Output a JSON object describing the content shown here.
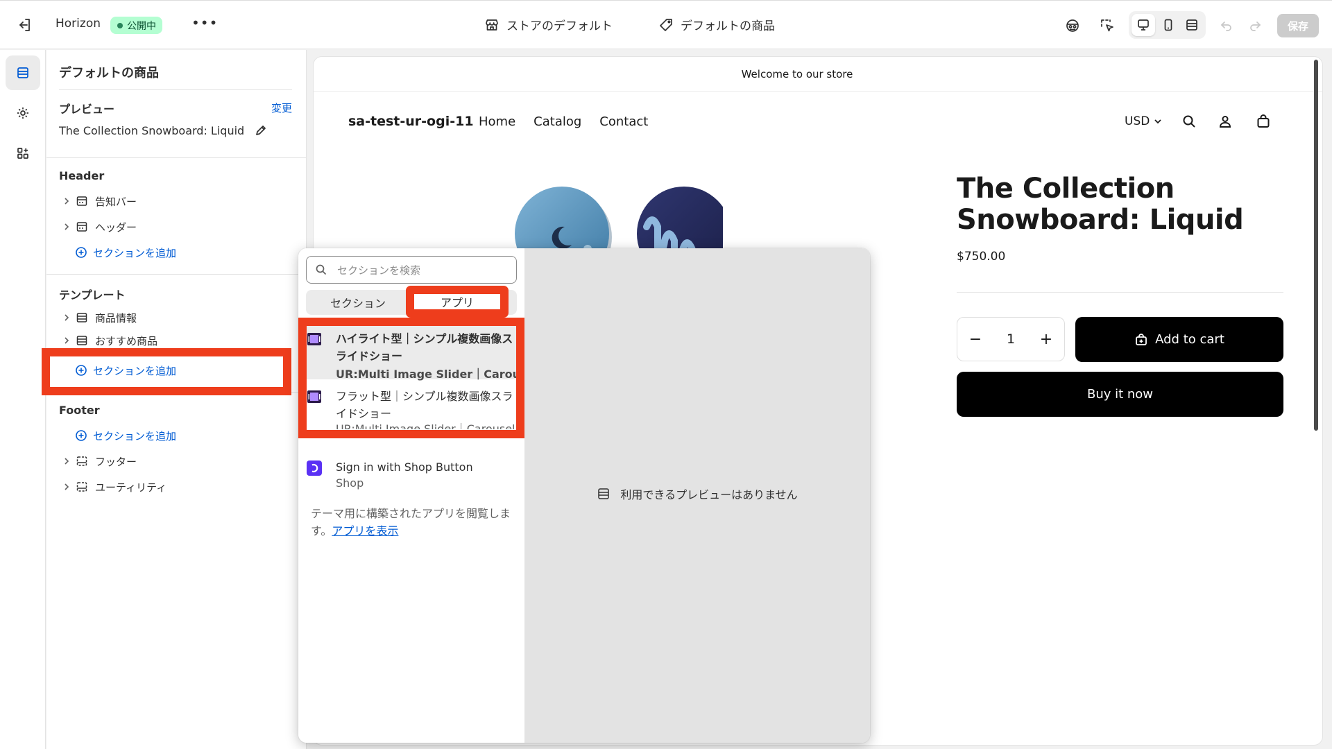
{
  "topbar": {
    "app_name": "Horizon",
    "status_badge": "公開中",
    "store_default_label": "ストアのデフォルト",
    "default_product_label": "デフォルトの商品",
    "save_label": "保存"
  },
  "panel": {
    "title": "デフォルトの商品",
    "preview_heading": "プレビュー",
    "change_link": "変更",
    "preview_product": "The Collection Snowboard: Liquid",
    "header_heading": "Header",
    "header_items": [
      "告知バー",
      "ヘッダー"
    ],
    "add_section_label": "セクションを追加",
    "template_heading": "テンプレート",
    "template_items": [
      "商品情報",
      "おすすめ商品"
    ],
    "footer_heading": "Footer",
    "footer_items": [
      "フッター",
      "ユーティリティ"
    ]
  },
  "storefront": {
    "announcement": "Welcome to our store",
    "logo": "sa-test-ur-ogi-11",
    "nav": [
      "Home",
      "Catalog",
      "Contact"
    ],
    "currency": "USD",
    "product_title": "The Collection Snowboard: Liquid",
    "price": "$750.00",
    "quantity": "1",
    "add_to_cart": "Add to cart",
    "buy_now": "Buy it now"
  },
  "popover": {
    "search_placeholder": "セクションを検索",
    "tabs": [
      "セクション",
      "アプリ"
    ],
    "active_tab": "アプリ",
    "apps": [
      {
        "name": "ハイライト型｜シンプル複数画像スライドショー",
        "sub": "UR:Multi Image Slider｜Carousel"
      },
      {
        "name": "フラット型｜シンプル複数画像スライドショー",
        "sub": "UR:Multi Image Slider｜Carousel"
      },
      {
        "name": "Sign in with Shop Button",
        "sub": "Shop"
      }
    ],
    "browse_text": "テーマ用に構築されたアプリを閲覧します。",
    "browse_link": "アプリを表示",
    "no_preview": "利用できるプレビューはありません"
  },
  "colors": {
    "highlight": "#ee3d1c",
    "link": "#005bd3",
    "badge_bg": "#b4fed2",
    "app_icon": "#2b1a4a",
    "shop_icon": "#5a31f4"
  }
}
